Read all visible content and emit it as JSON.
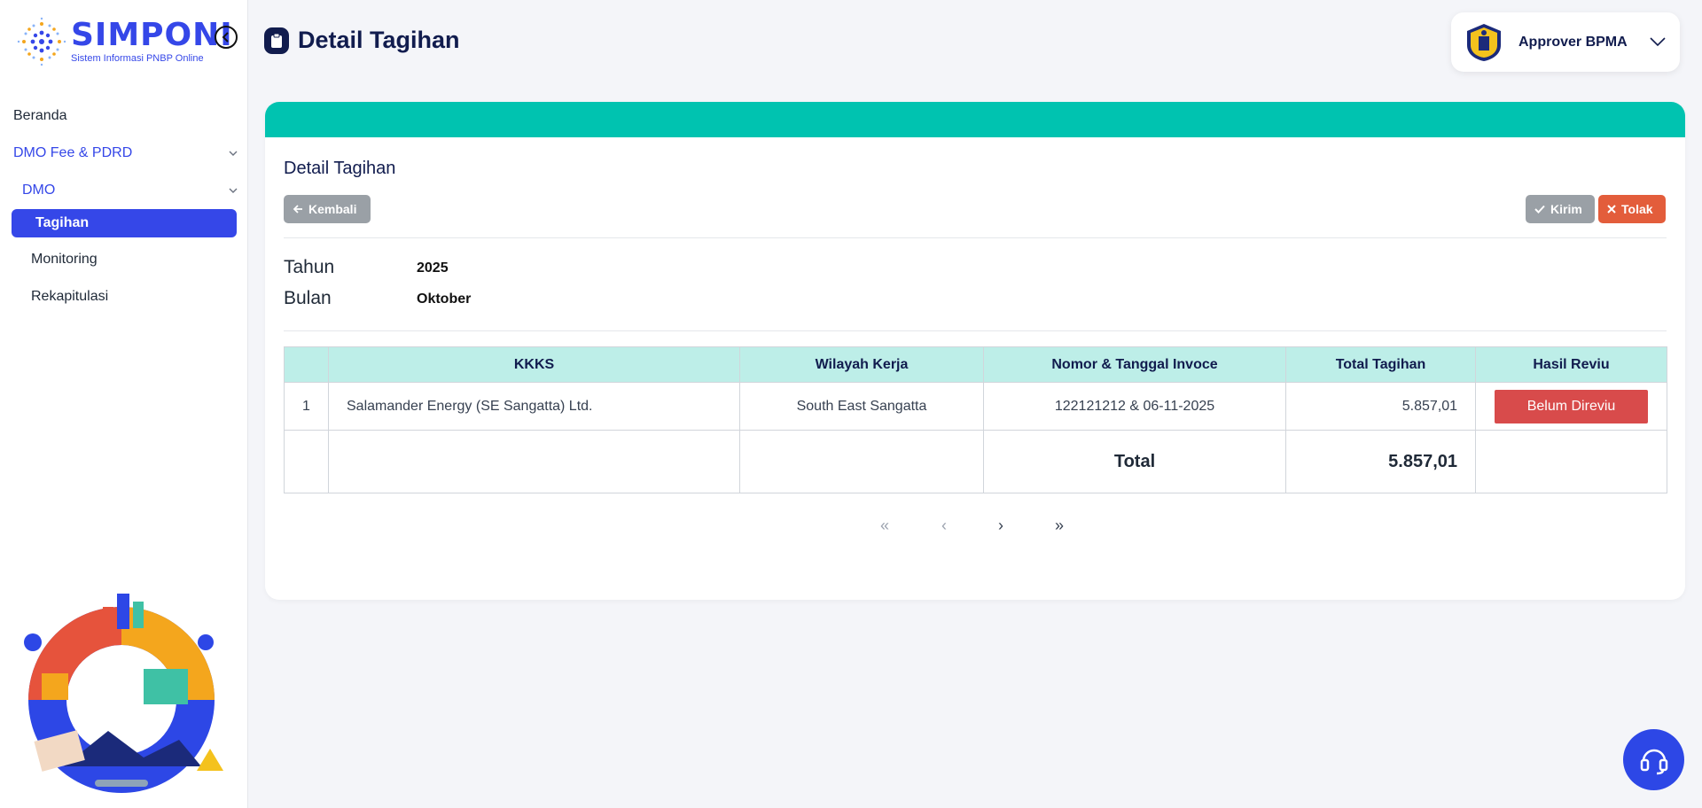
{
  "app": {
    "name": "SIMPONI",
    "tagline": "Sistem Informasi PNBP Online"
  },
  "sidebar": {
    "items": [
      {
        "label": "Beranda"
      },
      {
        "label": "DMO Fee & PDRD"
      },
      {
        "label": "DMO"
      },
      {
        "label": "Tagihan"
      },
      {
        "label": "Monitoring"
      },
      {
        "label": "Rekapitulasi"
      }
    ]
  },
  "header": {
    "title": "Detail Tagihan",
    "user": "Approver BPMA"
  },
  "card": {
    "title": "Detail Tagihan",
    "back_label": "Kembali",
    "send_label": "Kirim",
    "reject_label": "Tolak",
    "accent_color": "#00c3b0"
  },
  "info": {
    "tahun_label": "Tahun",
    "tahun_value": "2025",
    "bulan_label": "Bulan",
    "bulan_value": "Oktober"
  },
  "table": {
    "columns": [
      "",
      "KKKS",
      "Wilayah Kerja",
      "Nomor & Tanggal Invoce",
      "Total Tagihan",
      "Hasil Reviu"
    ],
    "rows": [
      {
        "no": "1",
        "kkks": "Salamander Energy (SE Sangatta) Ltd.",
        "wilayah": "South East Sangatta",
        "nomor": "122121212 & 06-11-2025",
        "total": "5.857,01",
        "status": "Belum Direviu"
      }
    ],
    "total_label": "Total",
    "total_value": "5.857,01"
  },
  "pagination": {
    "first": "«",
    "prev": "‹",
    "next": "›",
    "last": "»"
  },
  "icons": {
    "help": "headset-icon"
  }
}
